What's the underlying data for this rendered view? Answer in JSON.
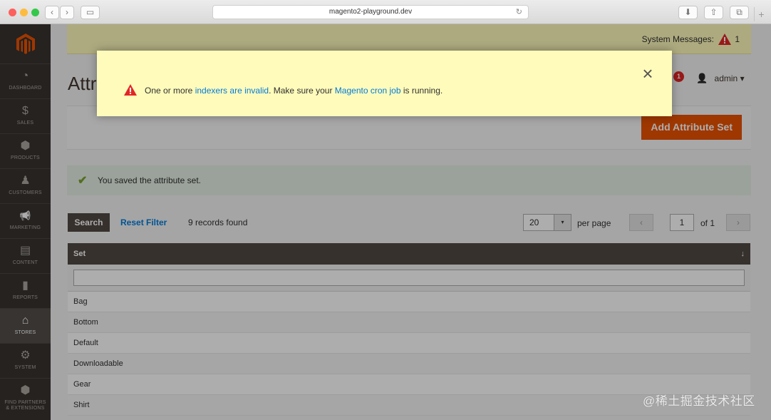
{
  "browser": {
    "url": "magento2-playground.dev",
    "back_glyph": "‹",
    "forward_glyph": "›",
    "sidebar_glyph": "▭",
    "reload_glyph": "↻",
    "download_glyph": "⬇",
    "share_glyph": "⇧",
    "tabs_glyph": "⧉",
    "new_tab_glyph": "+"
  },
  "sidebar": {
    "items": [
      {
        "label": "DASHBOARD",
        "icon": "dashboard-icon",
        "glyph": "◔"
      },
      {
        "label": "SALES",
        "icon": "dollar-icon",
        "glyph": "$"
      },
      {
        "label": "PRODUCTS",
        "icon": "cube-icon",
        "glyph": "⬢"
      },
      {
        "label": "CUSTOMERS",
        "icon": "person-icon",
        "glyph": "♟"
      },
      {
        "label": "MARKETING",
        "icon": "megaphone-icon",
        "glyph": "📢"
      },
      {
        "label": "CONTENT",
        "icon": "layout-icon",
        "glyph": "▤"
      },
      {
        "label": "REPORTS",
        "icon": "bar-chart-icon",
        "glyph": "▮"
      },
      {
        "label": "STORES",
        "icon": "store-icon",
        "glyph": "⌂"
      },
      {
        "label": "SYSTEM",
        "icon": "gear-icon",
        "glyph": "⚙"
      },
      {
        "label": "FIND PARTNERS & EXTENSIONS",
        "icon": "box-icon",
        "glyph": "⬢"
      }
    ]
  },
  "system_messages": {
    "label": "System Messages:",
    "count": "1"
  },
  "header": {
    "page_title": "Attri",
    "notifications_count": "1",
    "user": "admin",
    "user_glyph": "👤",
    "caret_glyph": "▾"
  },
  "actions": {
    "add_button": "Add Attribute Set"
  },
  "success_message": {
    "text": "You saved the attribute set.",
    "glyph": "✔"
  },
  "toolbar": {
    "search_button": "Search",
    "reset_filter": "Reset Filter",
    "records_found": "9 records found",
    "per_page_value": "20",
    "per_page_label": "per page",
    "page_value": "1",
    "page_of": "of 1",
    "prev_glyph": "‹",
    "next_glyph": "›",
    "select_arrow_glyph": "▾"
  },
  "grid": {
    "column_header": "Set",
    "sort_glyph": "↓",
    "rows": [
      "Bag",
      "Bottom",
      "Default",
      "Downloadable",
      "Gear",
      "Shirt"
    ]
  },
  "modal": {
    "text_before": "One or more ",
    "link1": "indexers are invalid",
    "text_middle": ". Make sure your ",
    "link2": "Magento cron job",
    "text_after": " is running.",
    "close_glyph": "×"
  },
  "watermark": "@稀土掘金技术社区",
  "colors": {
    "accent": "#eb5202",
    "sidebar_bg": "#373330",
    "link": "#007bdb",
    "warning_bg": "#fffbbb",
    "grid_header_bg": "#514943"
  }
}
